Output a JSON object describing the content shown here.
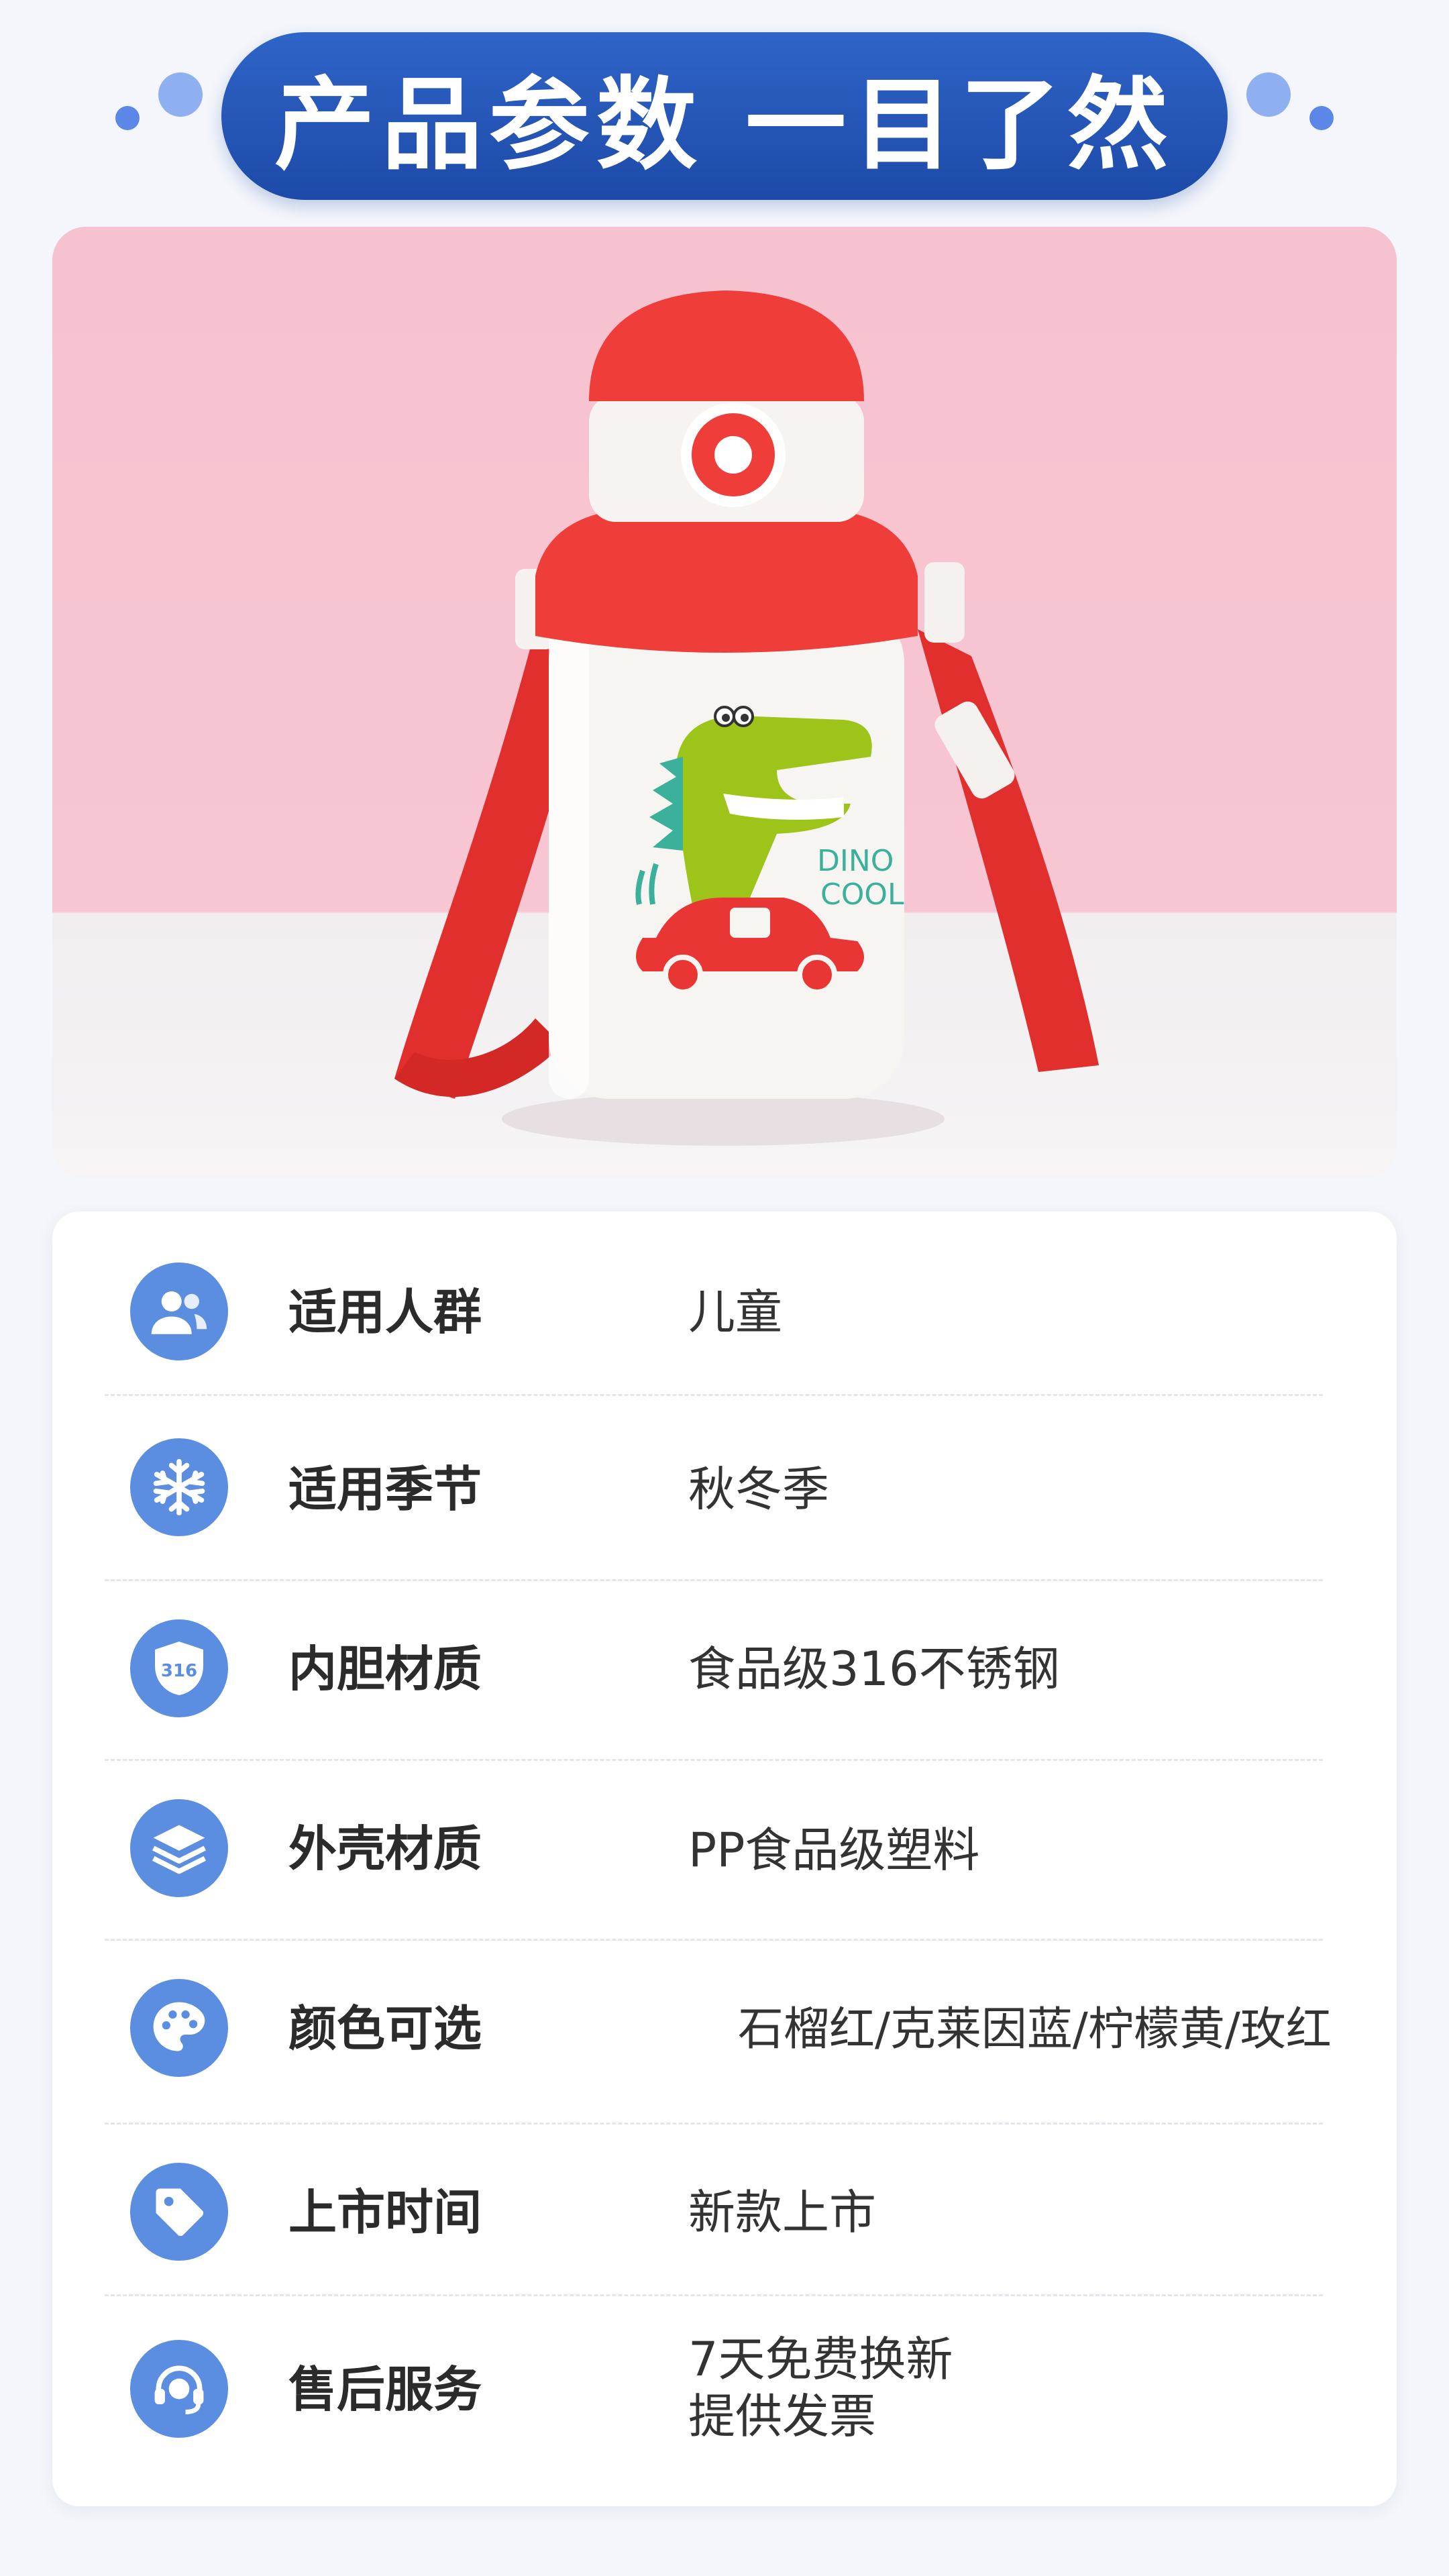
{
  "header": {
    "title": "产品参数 一目了然"
  },
  "product_image": {
    "brand_text_line1": "DINO",
    "brand_text_line2": "COOL"
  },
  "specs": [
    {
      "label": "适用人群",
      "value": "儿童",
      "icon": "users-icon"
    },
    {
      "label": "适用季节",
      "value": "秋冬季",
      "icon": "snowflake-icon"
    },
    {
      "label": "内胆材质",
      "value": "食品级316不锈钢",
      "icon": "shield-316-icon",
      "icon_text": "316"
    },
    {
      "label": "外壳材质",
      "value": "PP食品级塑料",
      "icon": "layers-icon"
    },
    {
      "label": "颜色可选",
      "value": "石榴红/克莱因蓝/柠檬黄/玫红",
      "icon": "palette-icon"
    },
    {
      "label": "上市时间",
      "value": "新款上市",
      "icon": "price-tag-icon"
    },
    {
      "label": "售后服务",
      "value": "7天免费换新",
      "value2": "提供发票",
      "icon": "headset-icon"
    }
  ],
  "colors": {
    "banner": "#1d4aa8",
    "icon_bg": "#5b8de0",
    "background": "#f4f6fb",
    "bottle_red": "#ef3e3a"
  }
}
